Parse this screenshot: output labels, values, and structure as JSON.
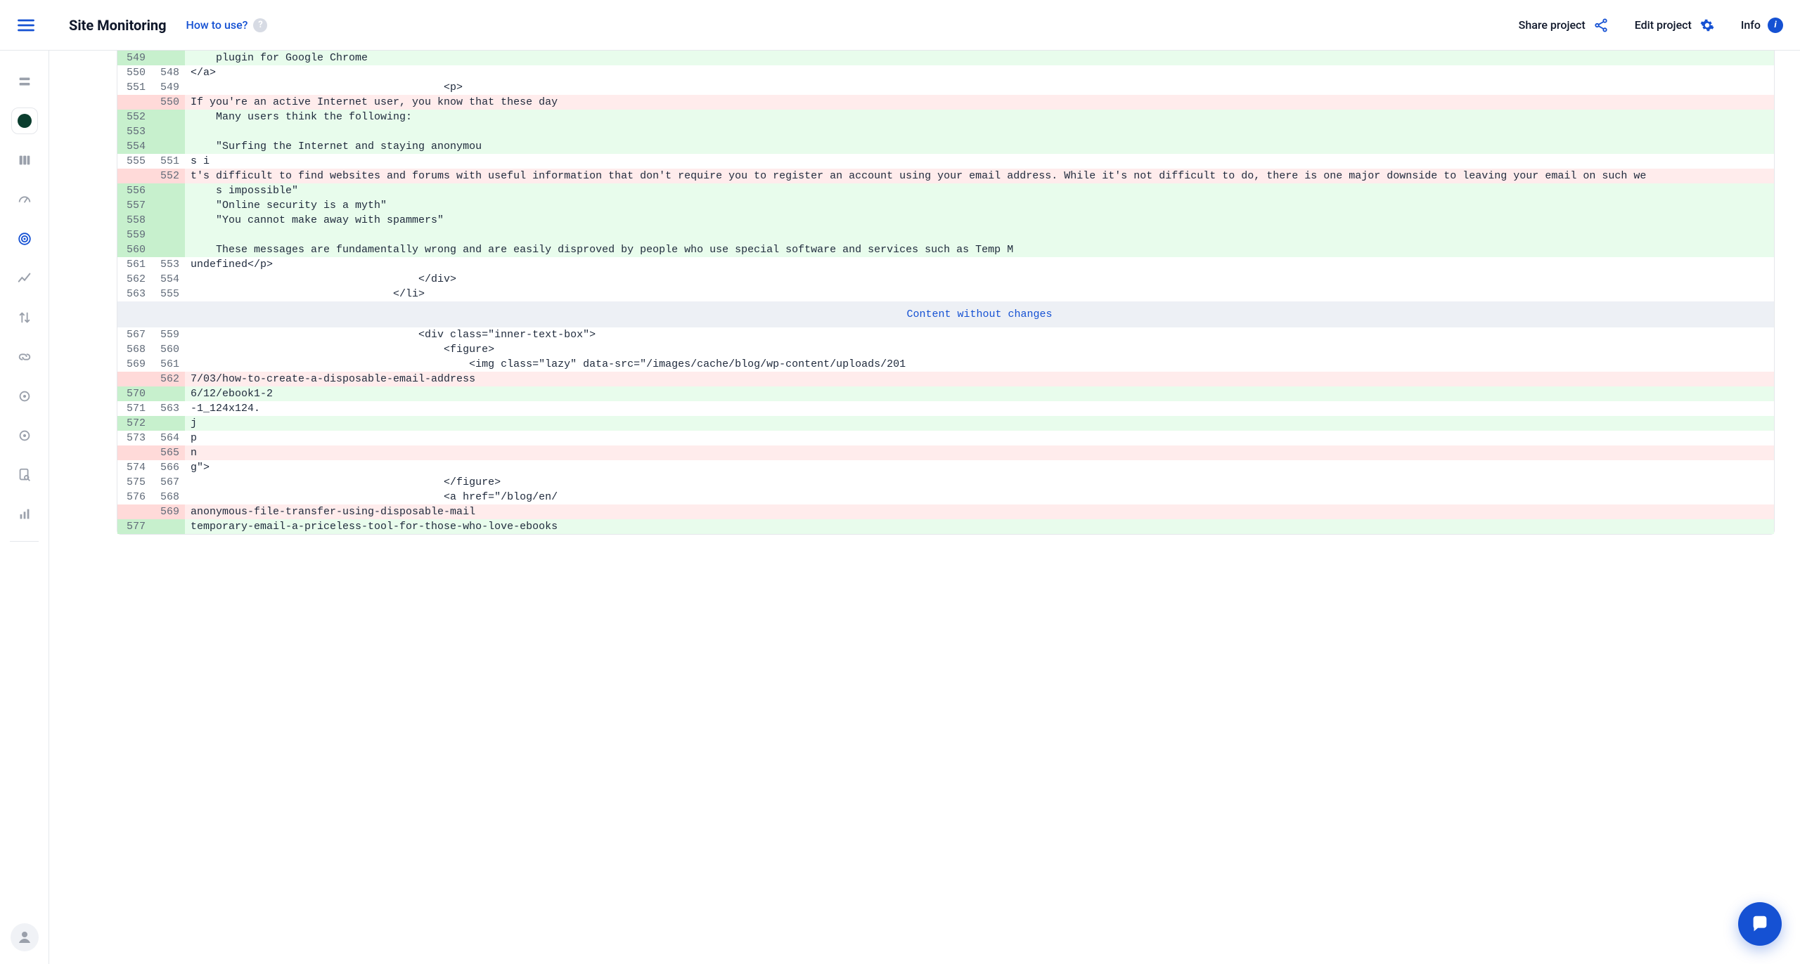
{
  "header": {
    "title": "Site Monitoring",
    "how_to": "How to use?",
    "share": "Share project",
    "edit": "Edit project",
    "info": "Info"
  },
  "hunk_label": "Content without changes",
  "rows": [
    {
      "t": "add",
      "l": "549",
      "r": "",
      "c": "    plugin for Google Chrome"
    },
    {
      "t": "ctx",
      "l": "550",
      "r": "548",
      "c": "</a>"
    },
    {
      "t": "ctx",
      "l": "551",
      "r": "549",
      "c": "                                        <p>"
    },
    {
      "t": "del",
      "l": "",
      "r": "550",
      "c": "If you're an active Internet user, you know that these day"
    },
    {
      "t": "add",
      "l": "552",
      "r": "",
      "c": "    Many users think the following:"
    },
    {
      "t": "add",
      "l": "553",
      "r": "",
      "c": ""
    },
    {
      "t": "add",
      "l": "554",
      "r": "",
      "c": "    \"Surfing the Internet and staying anonymou"
    },
    {
      "t": "ctx",
      "l": "555",
      "r": "551",
      "c": "s i"
    },
    {
      "t": "del",
      "l": "",
      "r": "552",
      "c": "t's difficult to find websites and forums with useful information that don't require you to register an account using your email address. While it's not difficult to do, there is one major downside to leaving your email on such we",
      "wrap": true
    },
    {
      "t": "add",
      "l": "556",
      "r": "",
      "c": "    s impossible\""
    },
    {
      "t": "add",
      "l": "557",
      "r": "",
      "c": "    \"Online security is a myth\""
    },
    {
      "t": "add",
      "l": "558",
      "r": "",
      "c": "    \"You cannot make away with spammers\""
    },
    {
      "t": "add",
      "l": "559",
      "r": "",
      "c": ""
    },
    {
      "t": "add",
      "l": "560",
      "r": "",
      "c": "    These messages are fundamentally wrong and are easily disproved by people who use special software and services such as Temp M"
    },
    {
      "t": "ctx",
      "l": "561",
      "r": "553",
      "c": "undefined</p>"
    },
    {
      "t": "ctx",
      "l": "562",
      "r": "554",
      "c": "                                    </div>"
    },
    {
      "t": "ctx",
      "l": "563",
      "r": "555",
      "c": "                                </li>"
    },
    {
      "t": "hunk"
    },
    {
      "t": "ctx",
      "l": "567",
      "r": "559",
      "c": "                                    <div class=\"inner-text-box\">"
    },
    {
      "t": "ctx",
      "l": "568",
      "r": "560",
      "c": "                                        <figure>"
    },
    {
      "t": "ctx",
      "l": "569",
      "r": "561",
      "c": "                                            <img class=\"lazy\" data-src=\"/images/cache/blog/wp-content/uploads/201"
    },
    {
      "t": "del",
      "l": "",
      "r": "562",
      "c": "7/03/how-to-create-a-disposable-email-address"
    },
    {
      "t": "add",
      "l": "570",
      "r": "",
      "c": "6/12/ebook1-2"
    },
    {
      "t": "ctx",
      "l": "571",
      "r": "563",
      "c": "-1_124x124."
    },
    {
      "t": "add",
      "l": "572",
      "r": "",
      "c": "j"
    },
    {
      "t": "ctx",
      "l": "573",
      "r": "564",
      "c": "p"
    },
    {
      "t": "del",
      "l": "",
      "r": "565",
      "c": "n"
    },
    {
      "t": "ctx",
      "l": "574",
      "r": "566",
      "c": "g\">"
    },
    {
      "t": "ctx",
      "l": "575",
      "r": "567",
      "c": "                                        </figure>"
    },
    {
      "t": "ctx",
      "l": "576",
      "r": "568",
      "c": "                                        <a href=\"/blog/en/"
    },
    {
      "t": "del",
      "l": "",
      "r": "569",
      "c": "anonymous-file-transfer-using-disposable-mail"
    },
    {
      "t": "add",
      "l": "577",
      "r": "",
      "c": "temporary-email-a-priceless-tool-for-those-who-love-ebooks"
    }
  ]
}
